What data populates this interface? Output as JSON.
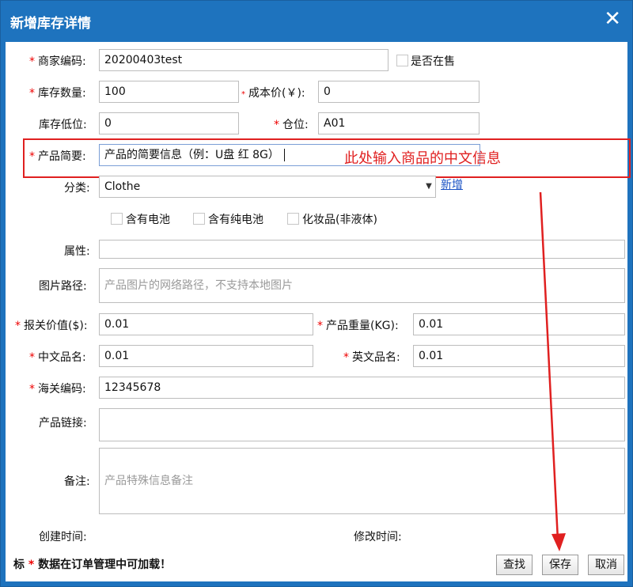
{
  "window": {
    "title": "新增库存详情",
    "close_glyph": "✕"
  },
  "form": {
    "sku_label": "商家编码:",
    "sku_value": "20200403test",
    "on_sale_label": "是否在售",
    "stock_qty_label": "库存数量:",
    "stock_qty_value": "100",
    "cost_label": "成本价(￥):",
    "cost_value": "0",
    "stock_low_label": "库存低位:",
    "stock_low_value": "0",
    "warehouse_label": "仓位:",
    "warehouse_value": "A01",
    "summary_label": "产品简要:",
    "summary_value": "产品的简要信息（例：U盘 红 8G）",
    "category_label": "分类:",
    "category_value": "Clothe",
    "category_add_link": "新增",
    "battery_label": "含有电池",
    "pure_battery_label": "含有纯电池",
    "cosmetics_label": "化妆品(非液体)",
    "attr_label": "属性:",
    "attr_value": "",
    "image_path_label": "图片路径:",
    "image_path_placeholder": "产品图片的网络路径，不支持本地图片",
    "declared_value_label": "报关价值($):",
    "declared_value_value": "0.01",
    "weight_label": "产品重量(KG):",
    "weight_value": "0.01",
    "cn_name_label": "中文品名:",
    "cn_name_value": "0.01",
    "en_name_label": "英文品名:",
    "en_name_value": "0.01",
    "hs_code_label": "海关编码:",
    "hs_code_value": "12345678",
    "product_link_label": "产品链接:",
    "product_link_value": "",
    "remark_label": "备注:",
    "remark_placeholder": "产品特殊信息备注",
    "created_label": "创建时间:",
    "modified_label": "修改时间:"
  },
  "annotation": {
    "text": "此处输入商品的中文信息",
    "color": "#e02020"
  },
  "footer": {
    "note_prefix": "标",
    "note_star": "*",
    "note_text": "数据在订单管理中可加载！",
    "search_button": "查找",
    "save_button": "保存",
    "cancel_button": "取消"
  },
  "colors": {
    "titlebar": "#1e73be",
    "required": "#e00000",
    "link": "#1a52c4"
  }
}
